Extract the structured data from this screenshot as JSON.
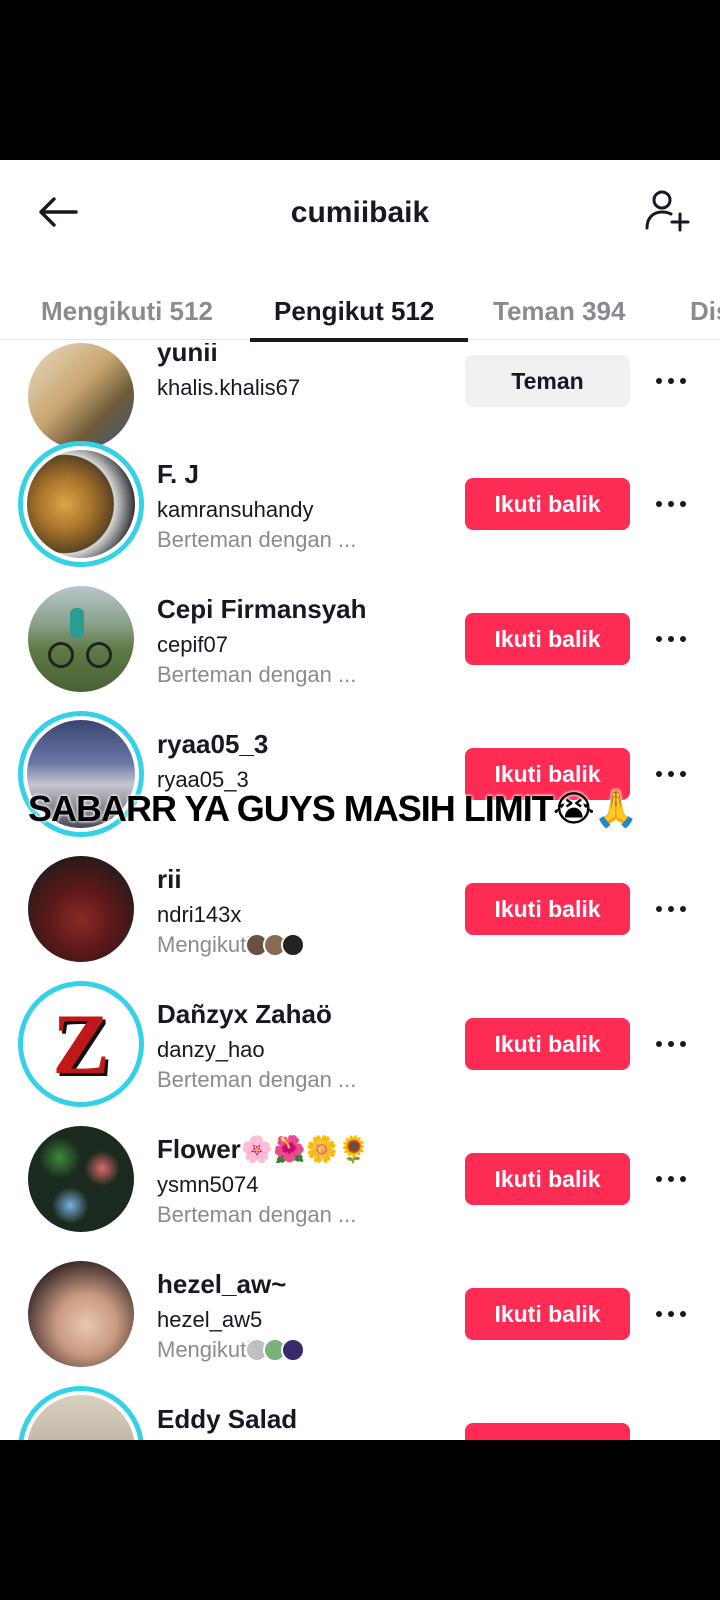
{
  "header": {
    "title": "cumiibaik"
  },
  "tabs": [
    {
      "label": "Mengikuti 512"
    },
    {
      "label": "Pengikut 512"
    },
    {
      "label": "Teman 394"
    },
    {
      "label": "Dis"
    }
  ],
  "rows": [
    {
      "name": "yunii",
      "handle": "khalis.khalis67",
      "sub": "",
      "button": "Teman"
    },
    {
      "name": "F. J",
      "handle": "kamransuhandy",
      "sub": "Berteman dengan ...",
      "button": "Ikuti balik"
    },
    {
      "name": "Cepi Firmansyah",
      "handle": "cepif07",
      "sub": "Berteman dengan ...",
      "button": "Ikuti balik"
    },
    {
      "name": "ryaa05_3",
      "handle": "ryaa05_3",
      "sub": "",
      "button": "Ikuti balik"
    },
    {
      "name": "rii",
      "handle": "ndri143x",
      "sub": "Mengikuti",
      "button": "Ikuti balik"
    },
    {
      "name": "Dañzyx Zahaö",
      "handle": "danzy_hao",
      "sub": "Berteman dengan ...",
      "button": "Ikuti balik"
    },
    {
      "name": "Flower🌸🌺🌼🌻",
      "handle": "ysmn5074",
      "sub": "Berteman dengan ...",
      "button": "Ikuti balik"
    },
    {
      "name": "hezel_aw~",
      "handle": "hezel_aw5",
      "sub": "Mengikuti",
      "button": "Ikuti balik"
    },
    {
      "name": "Eddy Salad",
      "handle": "",
      "sub": "",
      "button": ""
    }
  ],
  "overlay": {
    "text": "SABARR YA GUYS MASIH LIMIT😭🙏"
  },
  "colors": {
    "accent": "#fe2c55",
    "ring": "#35d2e7",
    "text": "#161823",
    "muted": "#8a8b91"
  }
}
